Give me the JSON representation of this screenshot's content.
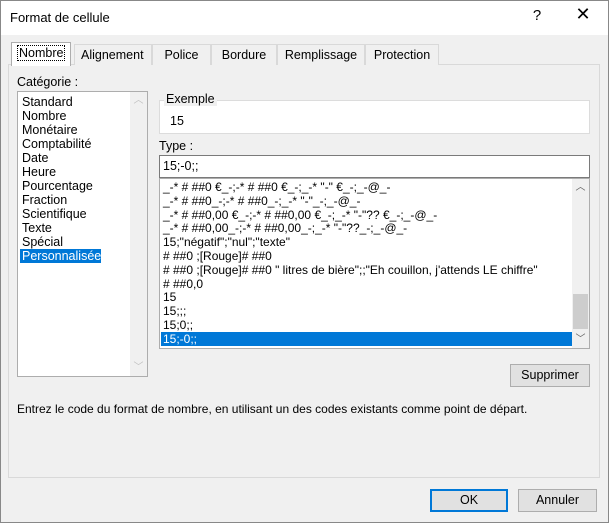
{
  "window": {
    "title": "Format de cellule",
    "help_label": "?",
    "close_label": "✕"
  },
  "tabs": [
    {
      "label": "Nombre",
      "active": true
    },
    {
      "label": "Alignement"
    },
    {
      "label": "Police"
    },
    {
      "label": "Bordure"
    },
    {
      "label": "Remplissage"
    },
    {
      "label": "Protection"
    }
  ],
  "category": {
    "label": "Catégorie :",
    "items": [
      "Standard",
      "Nombre",
      "Monétaire",
      "Comptabilité",
      "Date",
      "Heure",
      "Pourcentage",
      "Fraction",
      "Scientifique",
      "Texte",
      "Spécial",
      "Personnalisée"
    ],
    "selected": "Personnalisée"
  },
  "example": {
    "label": "Exemple",
    "value": "15"
  },
  "type": {
    "label": "Type :",
    "value": "15;-0;;"
  },
  "formats": {
    "items": [
      "_-* # ##0 €_-;-* # ##0 €_-;_-* \"-\" €_-;_-@_-",
      "_-* # ##0_-;-* # ##0_-;_-* \"-\"_-;_-@_-",
      "_-* # ##0,00 €_-;-* # ##0,00 €_-;_-* \"-\"?? €_-;_-@_-",
      "_-* # ##0,00_-;-* # ##0,00_-;_-* \"-\"??_-;_-@_-",
      "15;\"négatif\";\"nul\";\"texte\"",
      "# ##0 ;[Rouge]# ##0",
      "# ##0 ;[Rouge]# ##0 \" litres de bière\";;\"Eh couillon, j'attends LE chiffre\"",
      "# ##0,0",
      "15",
      "15;;;",
      "15;0;;",
      "15;-0;;"
    ],
    "selected": "15;-0;;"
  },
  "buttons": {
    "delete": "Supprimer",
    "ok": "OK",
    "cancel": "Annuler"
  },
  "description": "Entrez le code du format de nombre, en utilisant un des codes existants comme point de départ.",
  "colors": {
    "selection": "#0078d7",
    "ok_border": "#0078d7"
  }
}
